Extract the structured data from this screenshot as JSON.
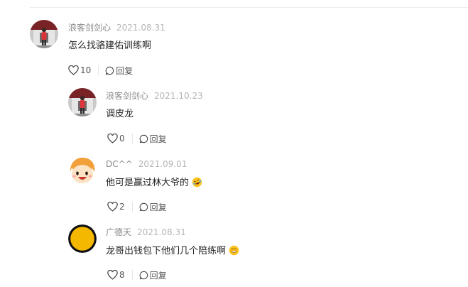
{
  "comments": [
    {
      "author": "浪客剑剑心",
      "date": "2021.08.31",
      "text": "怎么找骆建佑训练啊",
      "likes": "10",
      "reply_label": "回复",
      "avatar_icon": "user-photo-avatar"
    },
    {
      "author": "浪客剑剑心",
      "date": "2021.10.23",
      "text": "调皮龙",
      "likes": "0",
      "reply_label": "回复",
      "avatar_icon": "user-photo-avatar"
    },
    {
      "author": "DC^^",
      "date": "2021.09.01",
      "text": "他可是赢过林大爷的",
      "emoji": "rolling-laugh-emoji",
      "likes": "2",
      "reply_label": "回复",
      "avatar_icon": "cartoon-face-avatar"
    },
    {
      "author": "广德天",
      "date": "2021.08.31",
      "text": "龙哥出钱包下他们几个陪练啊",
      "emoji": "grinning-emoji",
      "likes": "8",
      "reply_label": "回复",
      "avatar_icon": "yellow-circle-avatar"
    }
  ],
  "colors": {
    "like_icon": "#444444",
    "reply_icon": "#444444",
    "author": "#8a8a8a",
    "date": "#b5b5b5",
    "yellow_avatar": "#f5b800"
  }
}
